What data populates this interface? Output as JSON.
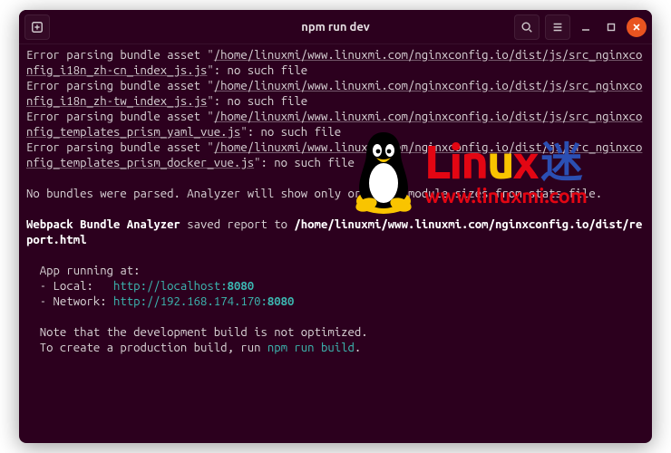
{
  "titlebar": {
    "title": "npm run dev"
  },
  "terminal": {
    "errors": [
      {
        "prefix": "Error parsing bundle asset \"",
        "path": "/home/linuxmi/www.linuxmi.com/nginxconfig.io/dist/js/src_nginxconfig_i18n_zh-cn_index_js.js",
        "suffix": "\": no such file"
      },
      {
        "prefix": "Error parsing bundle asset \"",
        "path": "/home/linuxmi/www.linuxmi.com/nginxconfig.io/dist/js/src_nginxconfig_i18n_zh-tw_index_js.js",
        "suffix": "\": no such file"
      },
      {
        "prefix": "Error parsing bundle asset \"",
        "path": "/home/linuxmi/www.linuxmi.com/nginxconfig.io/dist/js/src_nginxconfig_templates_prism_yaml_vue.js",
        "suffix": "\": no such file"
      },
      {
        "prefix": "Error parsing bundle asset \"",
        "path": "/home/linuxmi/www.linuxmi.com/nginxconfig.io/dist/js/src_nginxconfig_templates_prism_docker_vue.js",
        "suffix": "\": no such file"
      }
    ],
    "noBundles": "No bundles were parsed. Analyzer will show only original module sizes from stats file.",
    "webpack_prefix": "Webpack Bundle Analyzer",
    "webpack_middle": " saved report to ",
    "webpack_path": "/home/linuxmi/www.linuxmi.com/nginxconfig.io/dist/report.html",
    "app_running_at": "  App running at:",
    "local_label": "  - Local:   ",
    "local_url": "http://localhost:",
    "local_port": "8080",
    "network_label": "  - Network: ",
    "network_url": "http://192.168.174.170:",
    "network_port": "8080",
    "note1": "  Note that the development build is not optimized.",
    "note2_prefix": "  To create a production build, run ",
    "note2_cmd": "npm run build",
    "note2_suffix": "."
  },
  "watermark": {
    "brand_letters": [
      "L",
      "i",
      "n",
      "u",
      "x"
    ],
    "brand_cn": "迷",
    "url": "www.linuxmi.com"
  }
}
